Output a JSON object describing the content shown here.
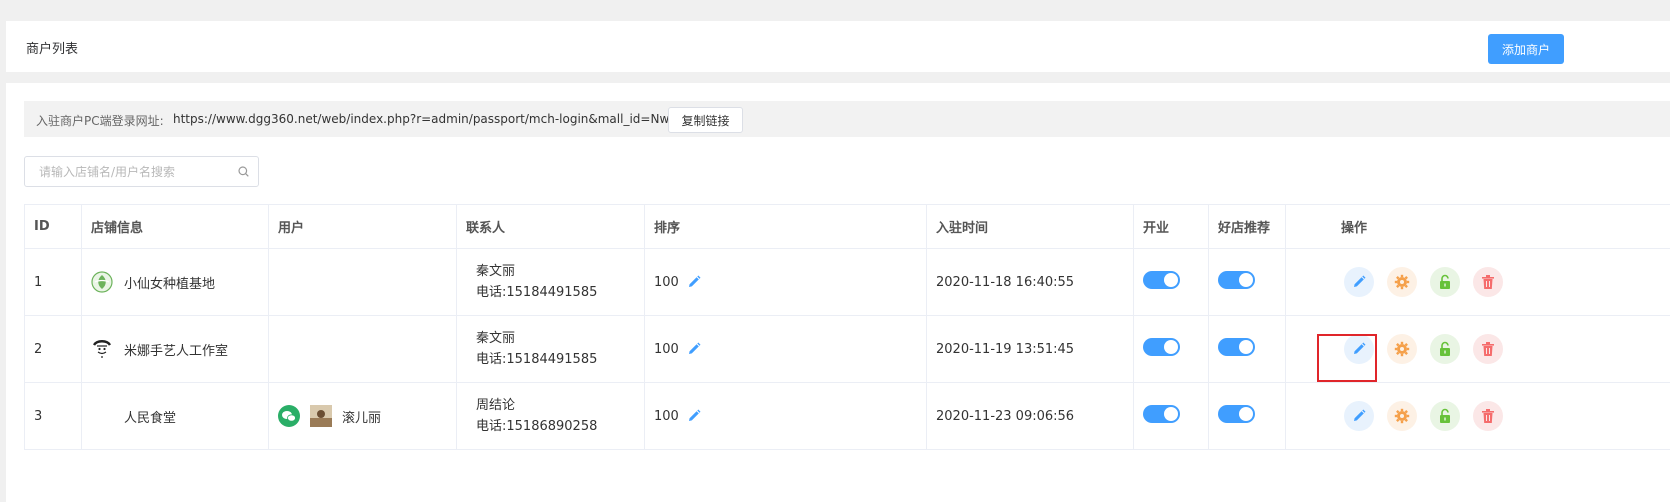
{
  "header": {
    "title": "商户列表",
    "add_button": "添加商户"
  },
  "login_url": {
    "label": "入驻商户PC端登录网址:",
    "value": "https://www.dgg360.net/web/index.php?r=admin/passport/mch-login&mall_id=Nw==",
    "copy_button": "复制链接"
  },
  "search": {
    "placeholder": "请输入店铺名/用户名搜索",
    "icon": "search-icon"
  },
  "table": {
    "columns": [
      "ID",
      "店铺信息",
      "用户",
      "联系人",
      "排序",
      "入驻时间",
      "开业",
      "好店推荐",
      "操作"
    ],
    "rows": [
      {
        "id": "1",
        "store": "小仙女种植基地",
        "store_logo": "green-leaf-logo",
        "user": "",
        "contact_name": "秦文丽",
        "contact_phone": "电话:15184491585",
        "sort": "100",
        "joined": "2020-11-18 16:40:55",
        "open": true,
        "recommend": true
      },
      {
        "id": "2",
        "store": "米娜手艺人工作室",
        "store_logo": "face-sketch-logo",
        "user": "",
        "contact_name": "秦文丽",
        "contact_phone": "电话:15184491585",
        "sort": "100",
        "joined": "2020-11-19 13:51:45",
        "open": true,
        "recommend": true
      },
      {
        "id": "3",
        "store": "人民食堂",
        "store_logo": "",
        "user": "滚儿丽",
        "user_icons": [
          "wechat-icon",
          "user-avatar"
        ],
        "contact_name": "周结论",
        "contact_phone": "电话:15186890258",
        "sort": "100",
        "joined": "2020-11-23 09:06:56",
        "open": true,
        "recommend": true
      }
    ]
  },
  "actions": [
    "edit-icon",
    "gear-icon",
    "unlock-icon",
    "delete-icon"
  ],
  "colors": {
    "primary": "#409eff",
    "edit_bg": "#e8f2fd",
    "gear": "#f5a04a",
    "lock": "#67c23a",
    "delete": "#f56c6c",
    "highlight": "#e0252a"
  }
}
